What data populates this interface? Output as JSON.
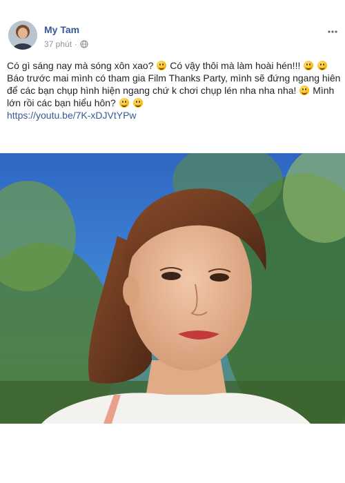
{
  "post": {
    "author": "My Tam",
    "time": "37 phút",
    "separator": "·",
    "lines": [
      "Có gì sáng nay mà sóng xôn xao?",
      "Có vậy thôi mà làm hoài hén!!!",
      "Báo trước mai mình có tham gia Film Thanks Party, mình sẽ đứng ngang hiên để các bạn chụp hình hiện ngang chứ k chơi chụp lén nha nha nha!",
      "Mình lớn rồi các bạn hiểu hôn?"
    ],
    "link": "https://youtu.be/7K-xDJVtYPw"
  },
  "icons": {
    "globe": "globe-icon",
    "more": "more-options-icon",
    "emoji": "smiling-face-emoji"
  },
  "colors": {
    "author": "#385898",
    "link": "#385898",
    "meta": "#90949c",
    "text": "#1d2129"
  }
}
